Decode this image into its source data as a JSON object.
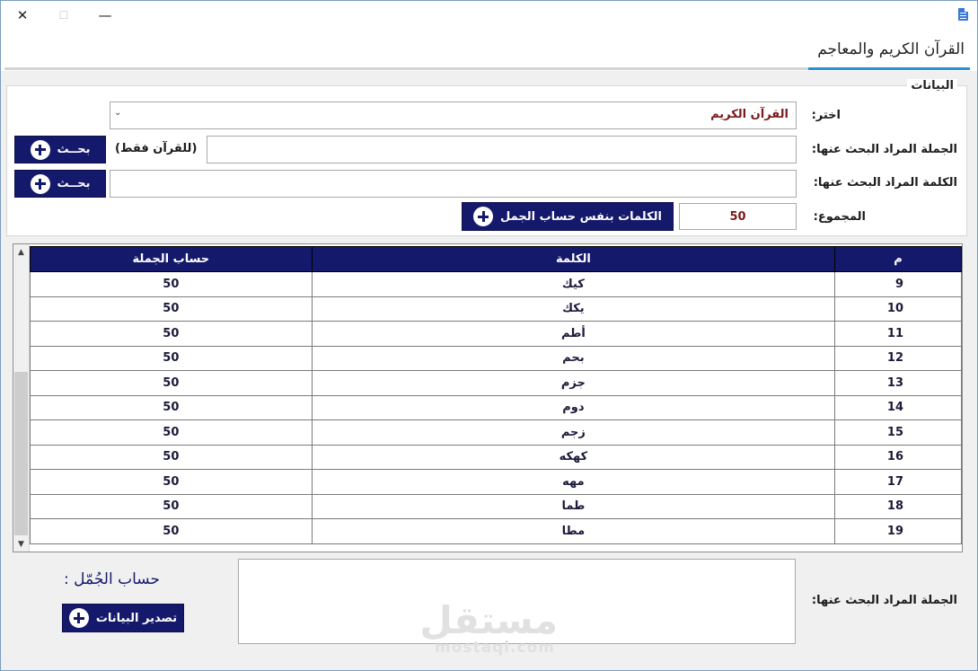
{
  "window": {
    "tab_title": "القرآن الكريم والمعاجم"
  },
  "group": {
    "legend": "البيانات",
    "choose_label": "اختر:",
    "choose_value": "القرآن الكريم",
    "sentence_label": "الجملة المراد البحث عنها:",
    "sentence_note": "(للقرآن فقط)",
    "word_label": "الكلمة المراد البحث عنها:",
    "search_label": "بحــث",
    "total_label": "المجموع:",
    "total_value": "50",
    "same_calc_button": "الكلمات بنفس حساب الجمل"
  },
  "grid": {
    "headers": [
      "م",
      "الكلمة",
      "حساب الجملة"
    ],
    "rows": [
      [
        "9",
        "كيك",
        "50"
      ],
      [
        "10",
        "يكك",
        "50"
      ],
      [
        "11",
        "أطم",
        "50"
      ],
      [
        "12",
        "بحم",
        "50"
      ],
      [
        "13",
        "جزم",
        "50"
      ],
      [
        "14",
        "دوم",
        "50"
      ],
      [
        "15",
        "زجم",
        "50"
      ],
      [
        "16",
        "كهكه",
        "50"
      ],
      [
        "17",
        "مهه",
        "50"
      ],
      [
        "18",
        "طما",
        "50"
      ],
      [
        "19",
        "مطا",
        "50"
      ]
    ]
  },
  "bottom": {
    "sentence_label": "الجملة المراد البحث عنها:",
    "jummal_title": "حساب الجُمّل :",
    "export_button": "تصدير البيانات",
    "watermark_ar": "مستقل",
    "watermark_en": "mostaql.com"
  }
}
